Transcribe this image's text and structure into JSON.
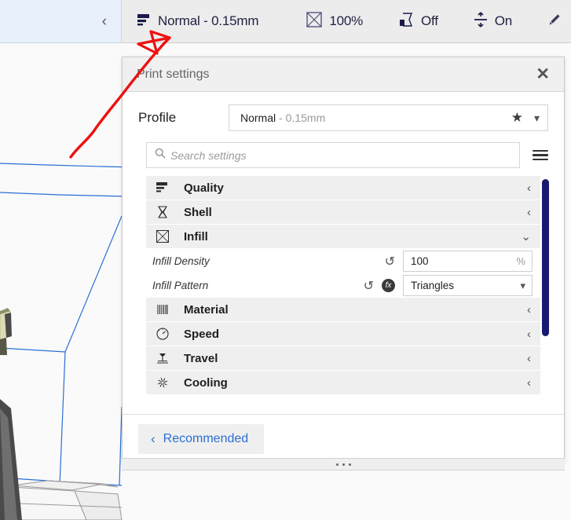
{
  "topbar": {
    "collapse_icon": "chevron-left-icon",
    "items": [
      {
        "icon": "quality-bars-icon",
        "label": "Normal - 0.15mm"
      },
      {
        "icon": "infill-mesh-icon",
        "label": "100%"
      },
      {
        "icon": "support-icon",
        "label": "Off"
      },
      {
        "icon": "adhesion-icon",
        "label": "On"
      },
      {
        "icon": "pencil-icon",
        "label": ""
      }
    ]
  },
  "dialog": {
    "title": "Print settings",
    "close_label": "✕",
    "profile": {
      "label": "Profile",
      "value_name": "Normal",
      "value_sub": "- 0.15mm",
      "favorite_icon": "star-icon",
      "dropdown_icon": "chevron-down-icon"
    },
    "search": {
      "placeholder": "Search settings",
      "value": "",
      "icon": "search-icon",
      "menu_icon": "hamburger-menu-icon"
    },
    "categories": [
      {
        "name": "Quality",
        "icon": "quality-bars-icon",
        "expanded": false,
        "chevron": "‹"
      },
      {
        "name": "Shell",
        "icon": "shell-icon",
        "expanded": false,
        "chevron": "‹"
      },
      {
        "name": "Infill",
        "icon": "infill-mesh-icon",
        "expanded": true,
        "chevron": "⌄"
      },
      {
        "name": "Material",
        "icon": "material-icon",
        "expanded": false,
        "chevron": "‹"
      },
      {
        "name": "Speed",
        "icon": "speed-gauge-icon",
        "expanded": false,
        "chevron": "‹"
      },
      {
        "name": "Travel",
        "icon": "travel-icon",
        "expanded": false,
        "chevron": "‹"
      },
      {
        "name": "Cooling",
        "icon": "cooling-fan-icon",
        "expanded": false,
        "chevron": "‹"
      }
    ],
    "infill_settings": [
      {
        "label": "Infill Density",
        "value": "100",
        "unit": "%",
        "type": "number",
        "revert_icon": "revert-arrow-icon",
        "has_formula": false
      },
      {
        "label": "Infill Pattern",
        "value": "Triangles",
        "unit": "",
        "type": "dropdown",
        "revert_icon": "revert-arrow-icon",
        "has_formula": true,
        "formula_icon": "fx-icon"
      }
    ],
    "footer": {
      "recommended_label": "Recommended",
      "recommended_chevron": "‹"
    },
    "scrollbar_color": "#191970"
  },
  "annotation": {
    "type": "arrow",
    "color": "#ee1111",
    "points_to": "Normal - 0.15mm"
  }
}
